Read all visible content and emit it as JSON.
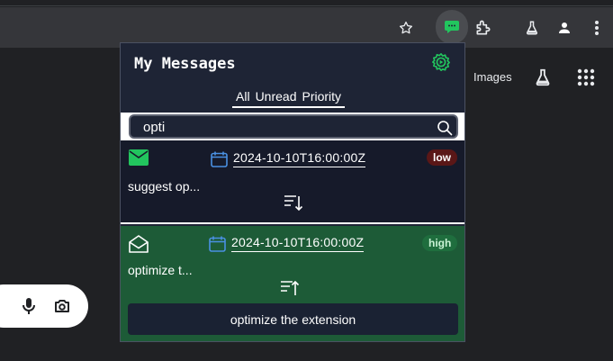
{
  "browser": {
    "page_link_images": "Images"
  },
  "popup": {
    "title": "My Messages",
    "tabs": [
      {
        "label": "All"
      },
      {
        "label": "Unread"
      },
      {
        "label": "Priority"
      }
    ],
    "search": {
      "value": "opti",
      "placeholder": ""
    },
    "messages": [
      {
        "date": "2024-10-10T16:00:00Z",
        "priority": "low",
        "snippet": "suggest op...",
        "icon": "envelope-closed-icon",
        "sort_icon": "sort-descending-icon"
      },
      {
        "date": "2024-10-10T16:00:00Z",
        "priority": "high",
        "snippet": "optimize t...",
        "icon": "envelope-open-icon",
        "sort_icon": "sort-ascending-icon",
        "expanded_text": "optimize the extension"
      }
    ]
  },
  "colors": {
    "popup_bg": "#1e2435",
    "accent_green": "#22c55e",
    "low_badge": "#5a1717",
    "high_badge": "#1f6e3e",
    "selected_msg_bg": "#1d5b37",
    "calendar_blue": "#4a90e2"
  }
}
